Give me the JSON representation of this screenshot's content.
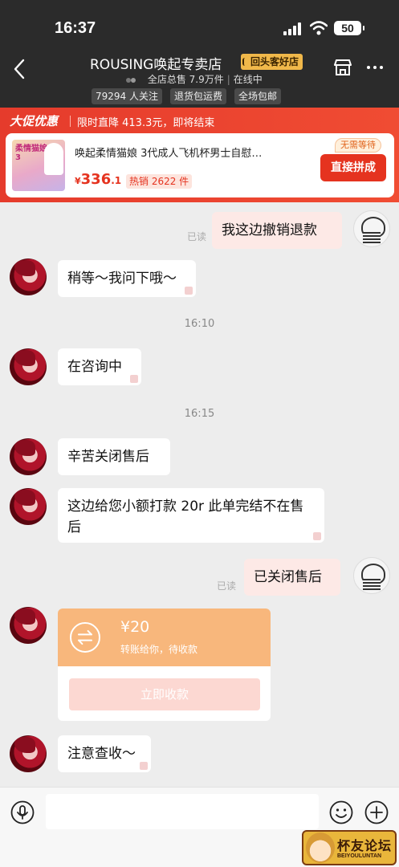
{
  "status_bar": {
    "time": "16:37",
    "battery": "50"
  },
  "header": {
    "store_name": "ROUSING唤起专卖店",
    "store_tag": "回头客好店",
    "sales": "全店总售 7.9万件",
    "online": "在线中",
    "chips": [
      "79294 人关注",
      "退货包运费",
      "全场包邮"
    ]
  },
  "promo": {
    "logo": "大促优惠",
    "text": "限时直降 413.3元，即将结束",
    "product": {
      "thumb_text": "柔情猫娘3",
      "title": "唤起柔情猫娘 3代成人飞机杯男士自慰…",
      "price_currency": "¥",
      "price_int": "336",
      "price_dec": ".1",
      "hot": "热销 2622 件",
      "no_wait": "无需等待",
      "buy_label": "直接拼成"
    }
  },
  "chat": {
    "read_label": "已读",
    "messages": [
      {
        "text": "我这边撤销退款"
      },
      {
        "text": "稍等～我问下哦～"
      },
      {
        "time": "16:10"
      },
      {
        "text": "在咨询中"
      },
      {
        "time": "16:15"
      },
      {
        "text": "辛苦关闭售后"
      },
      {
        "text": "这边给您小额打款 20r 此单完结不在售后"
      },
      {
        "text": "已关闭售后"
      },
      {
        "text": "注意查收～"
      }
    ],
    "transfer": {
      "amount": "¥20",
      "desc": "转账给你，待收款",
      "button": "立即收款"
    }
  },
  "watermark": {
    "title": "杯友论坛",
    "subtitle": "BEIYOULUNTAN"
  }
}
